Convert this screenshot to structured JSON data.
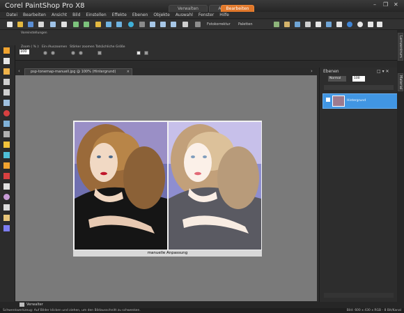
{
  "app": {
    "title": "Corel PaintShop Pro X8",
    "workspace_tabs": [
      {
        "label": "Verwalten"
      },
      {
        "label": "Anpassen"
      },
      {
        "label": "Bearbeiten"
      }
    ],
    "active_tab": "Bearbeiten",
    "accent_color": "#e0772a"
  },
  "menu": [
    "Datei",
    "Bearbeiten",
    "Ansicht",
    "Bild",
    "Einstellen",
    "Effekte",
    "Ebenen",
    "Objekte",
    "Auswahl",
    "Fenster",
    "Hilfe"
  ],
  "toolbar": {
    "fotokorrektur_label": "Fotokorrektur",
    "paletten_label": "Paletten"
  },
  "tool_options": {
    "voreinstellungen_label": "Voreinstellungen",
    "zoom_label": "Zoom ( % ):",
    "zoom_value": "100",
    "ein_auszoomen_label": "Ein-/Auszoomen",
    "staerker_zoomen_label": "Stärker zoomen",
    "tatsaechliche_groesse_label": "Tatsächliche Größe"
  },
  "document": {
    "tab_label": "psp-tonemap-manuell.jpg @ 100% (Hintergrund)",
    "close_icon": "×",
    "nav_left_icon": "‹",
    "nav_right_icon": "›",
    "caption": "manuelle Anpassung"
  },
  "layers_panel": {
    "title": "Ebenen",
    "blend_mode": "Normal",
    "opacity": "100",
    "layer_name": "Hintergrund",
    "highlight_color": "#4196e3"
  },
  "side_tabs": [
    "Lernzentrum",
    "Material"
  ],
  "bottom": {
    "verwalter_label": "Verwalter"
  },
  "status": {
    "left": "Schwenkwerkzeug: Auf Bilder klicken und ziehen, um den Bildausschnitt zu schwenken.",
    "right": "Bild: 600 x 430 x RGB - 8 Bit/Kanal"
  }
}
